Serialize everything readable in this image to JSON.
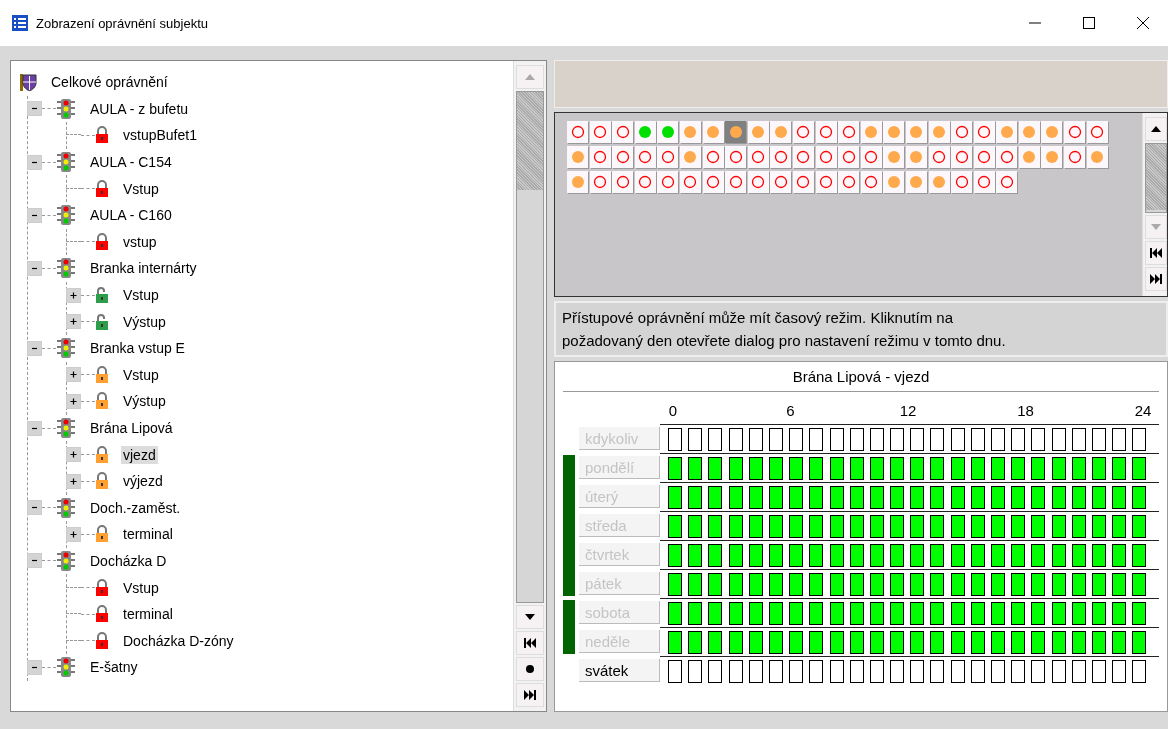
{
  "window": {
    "title": "Zobrazení oprávnění subjektu"
  },
  "tree": {
    "root": {
      "label": "Celkové oprávnění",
      "kind": "shield",
      "children": [
        {
          "label": "AULA -  z bufetu",
          "kind": "gate",
          "expanded": true,
          "children": [
            {
              "label": "vstupBufet1",
              "kind": "lock",
              "color": "#ff0000",
              "selected": false
            }
          ]
        },
        {
          "label": "AULA - C154",
          "kind": "gate",
          "expanded": true,
          "children": [
            {
              "label": "Vstup",
              "kind": "lock",
              "color": "#ff0000",
              "selected": false
            }
          ]
        },
        {
          "label": "AULA - C160",
          "kind": "gate",
          "expanded": true,
          "children": [
            {
              "label": "vstup",
              "kind": "lock",
              "color": "#ff0000",
              "selected": false
            }
          ]
        },
        {
          "label": "Branka internárty",
          "kind": "gate",
          "expanded": true,
          "children": [
            {
              "label": "Vstup",
              "kind": "open-lock",
              "color": "#2e9e4a",
              "expanded": false,
              "selected": false
            },
            {
              "label": "Výstup",
              "kind": "open-lock",
              "color": "#2e9e4a",
              "expanded": false,
              "selected": false
            }
          ]
        },
        {
          "label": "Branka vstup E",
          "kind": "gate",
          "expanded": true,
          "children": [
            {
              "label": "Vstup",
              "kind": "lock",
              "color": "#ffa030",
              "expanded": false,
              "selected": false
            },
            {
              "label": "Výstup",
              "kind": "lock",
              "color": "#ffa030",
              "expanded": false,
              "selected": false
            }
          ]
        },
        {
          "label": "Brána Lipová",
          "kind": "gate",
          "expanded": true,
          "children": [
            {
              "label": "vjezd",
              "kind": "lock",
              "color": "#ffa030",
              "expanded": false,
              "selected": true
            },
            {
              "label": "výjezd",
              "kind": "lock",
              "color": "#ffa030",
              "expanded": false,
              "selected": false
            }
          ]
        },
        {
          "label": "Doch.-zaměst.",
          "kind": "gate",
          "expanded": true,
          "children": [
            {
              "label": "terminal",
              "kind": "lock",
              "color": "#ffa030",
              "expanded": false,
              "selected": false
            }
          ]
        },
        {
          "label": "Docházka D",
          "kind": "gate",
          "expanded": true,
          "children": [
            {
              "label": "Vstup",
              "kind": "lock",
              "color": "#ff0000",
              "selected": false
            },
            {
              "label": "terminal",
              "kind": "lock",
              "color": "#ff0000",
              "selected": false
            },
            {
              "label": "Docházka D-zóny",
              "kind": "lock",
              "color": "#ff0000",
              "selected": false
            }
          ]
        },
        {
          "label": "E-šatny",
          "kind": "gate",
          "expanded": true
        }
      ]
    }
  },
  "day_grid": {
    "rows": [
      [
        {
          "kind": "none",
          "selected": false
        },
        {
          "kind": "none",
          "selected": false
        },
        {
          "kind": "none",
          "selected": false
        },
        {
          "kind": "full",
          "selected": false
        },
        {
          "kind": "full",
          "selected": false
        },
        {
          "kind": "partial",
          "selected": false
        },
        {
          "kind": "partial",
          "selected": false
        },
        {
          "kind": "partial",
          "selected": true
        },
        {
          "kind": "partial",
          "selected": false
        },
        {
          "kind": "partial",
          "selected": false
        },
        {
          "kind": "none",
          "selected": false
        },
        {
          "kind": "none",
          "selected": false
        },
        {
          "kind": "none",
          "selected": false
        },
        {
          "kind": "partial",
          "selected": false
        },
        {
          "kind": "partial",
          "selected": false
        },
        {
          "kind": "partial",
          "selected": false
        },
        {
          "kind": "partial",
          "selected": false
        },
        {
          "kind": "none",
          "selected": false
        },
        {
          "kind": "none",
          "selected": false
        },
        {
          "kind": "partial",
          "selected": false
        },
        {
          "kind": "partial",
          "selected": false
        },
        {
          "kind": "partial",
          "selected": false
        },
        {
          "kind": "none",
          "selected": false
        },
        {
          "kind": "none",
          "selected": false
        }
      ],
      [
        {
          "kind": "partial",
          "selected": false
        },
        {
          "kind": "none",
          "selected": false
        },
        {
          "kind": "none",
          "selected": false
        },
        {
          "kind": "none",
          "selected": false
        },
        {
          "kind": "none",
          "selected": false
        },
        {
          "kind": "partial",
          "selected": false
        },
        {
          "kind": "none",
          "selected": false
        },
        {
          "kind": "none",
          "selected": false
        },
        {
          "kind": "none",
          "selected": false
        },
        {
          "kind": "none",
          "selected": false
        },
        {
          "kind": "none",
          "selected": false
        },
        {
          "kind": "none",
          "selected": false
        },
        {
          "kind": "none",
          "selected": false
        },
        {
          "kind": "none",
          "selected": false
        },
        {
          "kind": "partial",
          "selected": false
        },
        {
          "kind": "partial",
          "selected": false
        },
        {
          "kind": "none",
          "selected": false
        },
        {
          "kind": "none",
          "selected": false
        },
        {
          "kind": "none",
          "selected": false
        },
        {
          "kind": "none",
          "selected": false
        },
        {
          "kind": "partial",
          "selected": false
        },
        {
          "kind": "partial",
          "selected": false
        },
        {
          "kind": "none",
          "selected": false
        },
        {
          "kind": "partial",
          "selected": false
        }
      ],
      [
        {
          "kind": "partial",
          "selected": false
        },
        {
          "kind": "none",
          "selected": false
        },
        {
          "kind": "none",
          "selected": false
        },
        {
          "kind": "none",
          "selected": false
        },
        {
          "kind": "none",
          "selected": false
        },
        {
          "kind": "none",
          "selected": false
        },
        {
          "kind": "none",
          "selected": false
        },
        {
          "kind": "none",
          "selected": false
        },
        {
          "kind": "none",
          "selected": false
        },
        {
          "kind": "none",
          "selected": false
        },
        {
          "kind": "none",
          "selected": false
        },
        {
          "kind": "none",
          "selected": false
        },
        {
          "kind": "none",
          "selected": false
        },
        {
          "kind": "none",
          "selected": false
        },
        {
          "kind": "partial",
          "selected": false
        },
        {
          "kind": "partial",
          "selected": false
        },
        {
          "kind": "partial",
          "selected": false
        },
        {
          "kind": "none",
          "selected": false
        },
        {
          "kind": "none",
          "selected": false
        },
        {
          "kind": "none",
          "selected": false
        }
      ]
    ]
  },
  "info": "Přístupové oprávnění může mít časový režim. Kliknutím na požadovaný den otevřete dialog pro nastavení režimu v tomto dnu.",
  "schedule": {
    "title": "Brána Lipová - vjezd",
    "ticks": [
      "0",
      "6",
      "12",
      "18",
      "24"
    ],
    "groups": [
      {
        "kind": "single",
        "days": [
          {
            "label": "kdykoliv",
            "disabled": true,
            "hours": [
              false,
              false,
              false,
              false,
              false,
              false,
              false,
              false,
              false,
              false,
              false,
              false,
              false,
              false,
              false,
              false,
              false,
              false,
              false,
              false,
              false,
              false,
              false,
              false
            ]
          }
        ]
      },
      {
        "kind": "bracket",
        "days": [
          {
            "label": "pondělí",
            "disabled": true,
            "hours": [
              true,
              true,
              true,
              true,
              true,
              true,
              true,
              true,
              true,
              true,
              true,
              true,
              true,
              true,
              true,
              true,
              true,
              true,
              true,
              true,
              true,
              true,
              true,
              true
            ]
          },
          {
            "label": "úterý",
            "disabled": true,
            "hours": [
              true,
              true,
              true,
              true,
              true,
              true,
              true,
              true,
              true,
              true,
              true,
              true,
              true,
              true,
              true,
              true,
              true,
              true,
              true,
              true,
              true,
              true,
              true,
              true
            ]
          },
          {
            "label": "středa",
            "disabled": true,
            "hours": [
              true,
              true,
              true,
              true,
              true,
              true,
              true,
              true,
              true,
              true,
              true,
              true,
              true,
              true,
              true,
              true,
              true,
              true,
              true,
              true,
              true,
              true,
              true,
              true
            ]
          },
          {
            "label": "čtvrtek",
            "disabled": true,
            "hours": [
              true,
              true,
              true,
              true,
              true,
              true,
              true,
              true,
              true,
              true,
              true,
              true,
              true,
              true,
              true,
              true,
              true,
              true,
              true,
              true,
              true,
              true,
              true,
              true
            ]
          },
          {
            "label": "pátek",
            "disabled": true,
            "hours": [
              true,
              true,
              true,
              true,
              true,
              true,
              true,
              true,
              true,
              true,
              true,
              true,
              true,
              true,
              true,
              true,
              true,
              true,
              true,
              true,
              true,
              true,
              true,
              true
            ]
          }
        ]
      },
      {
        "kind": "bracket",
        "days": [
          {
            "label": "sobota",
            "disabled": true,
            "hours": [
              true,
              true,
              true,
              true,
              true,
              true,
              true,
              true,
              true,
              true,
              true,
              true,
              true,
              true,
              true,
              true,
              true,
              true,
              true,
              true,
              true,
              true,
              true,
              true
            ]
          },
          {
            "label": "neděle",
            "disabled": true,
            "hours": [
              true,
              true,
              true,
              true,
              true,
              true,
              true,
              true,
              true,
              true,
              true,
              true,
              true,
              true,
              true,
              true,
              true,
              true,
              true,
              true,
              true,
              true,
              true,
              true
            ]
          }
        ]
      },
      {
        "kind": "single",
        "days": [
          {
            "label": "svátek",
            "disabled": false,
            "hours": [
              false,
              false,
              false,
              false,
              false,
              false,
              false,
              false,
              false,
              false,
              false,
              false,
              false,
              false,
              false,
              false,
              false,
              false,
              false,
              false,
              false,
              false,
              false,
              false
            ]
          }
        ]
      }
    ]
  }
}
